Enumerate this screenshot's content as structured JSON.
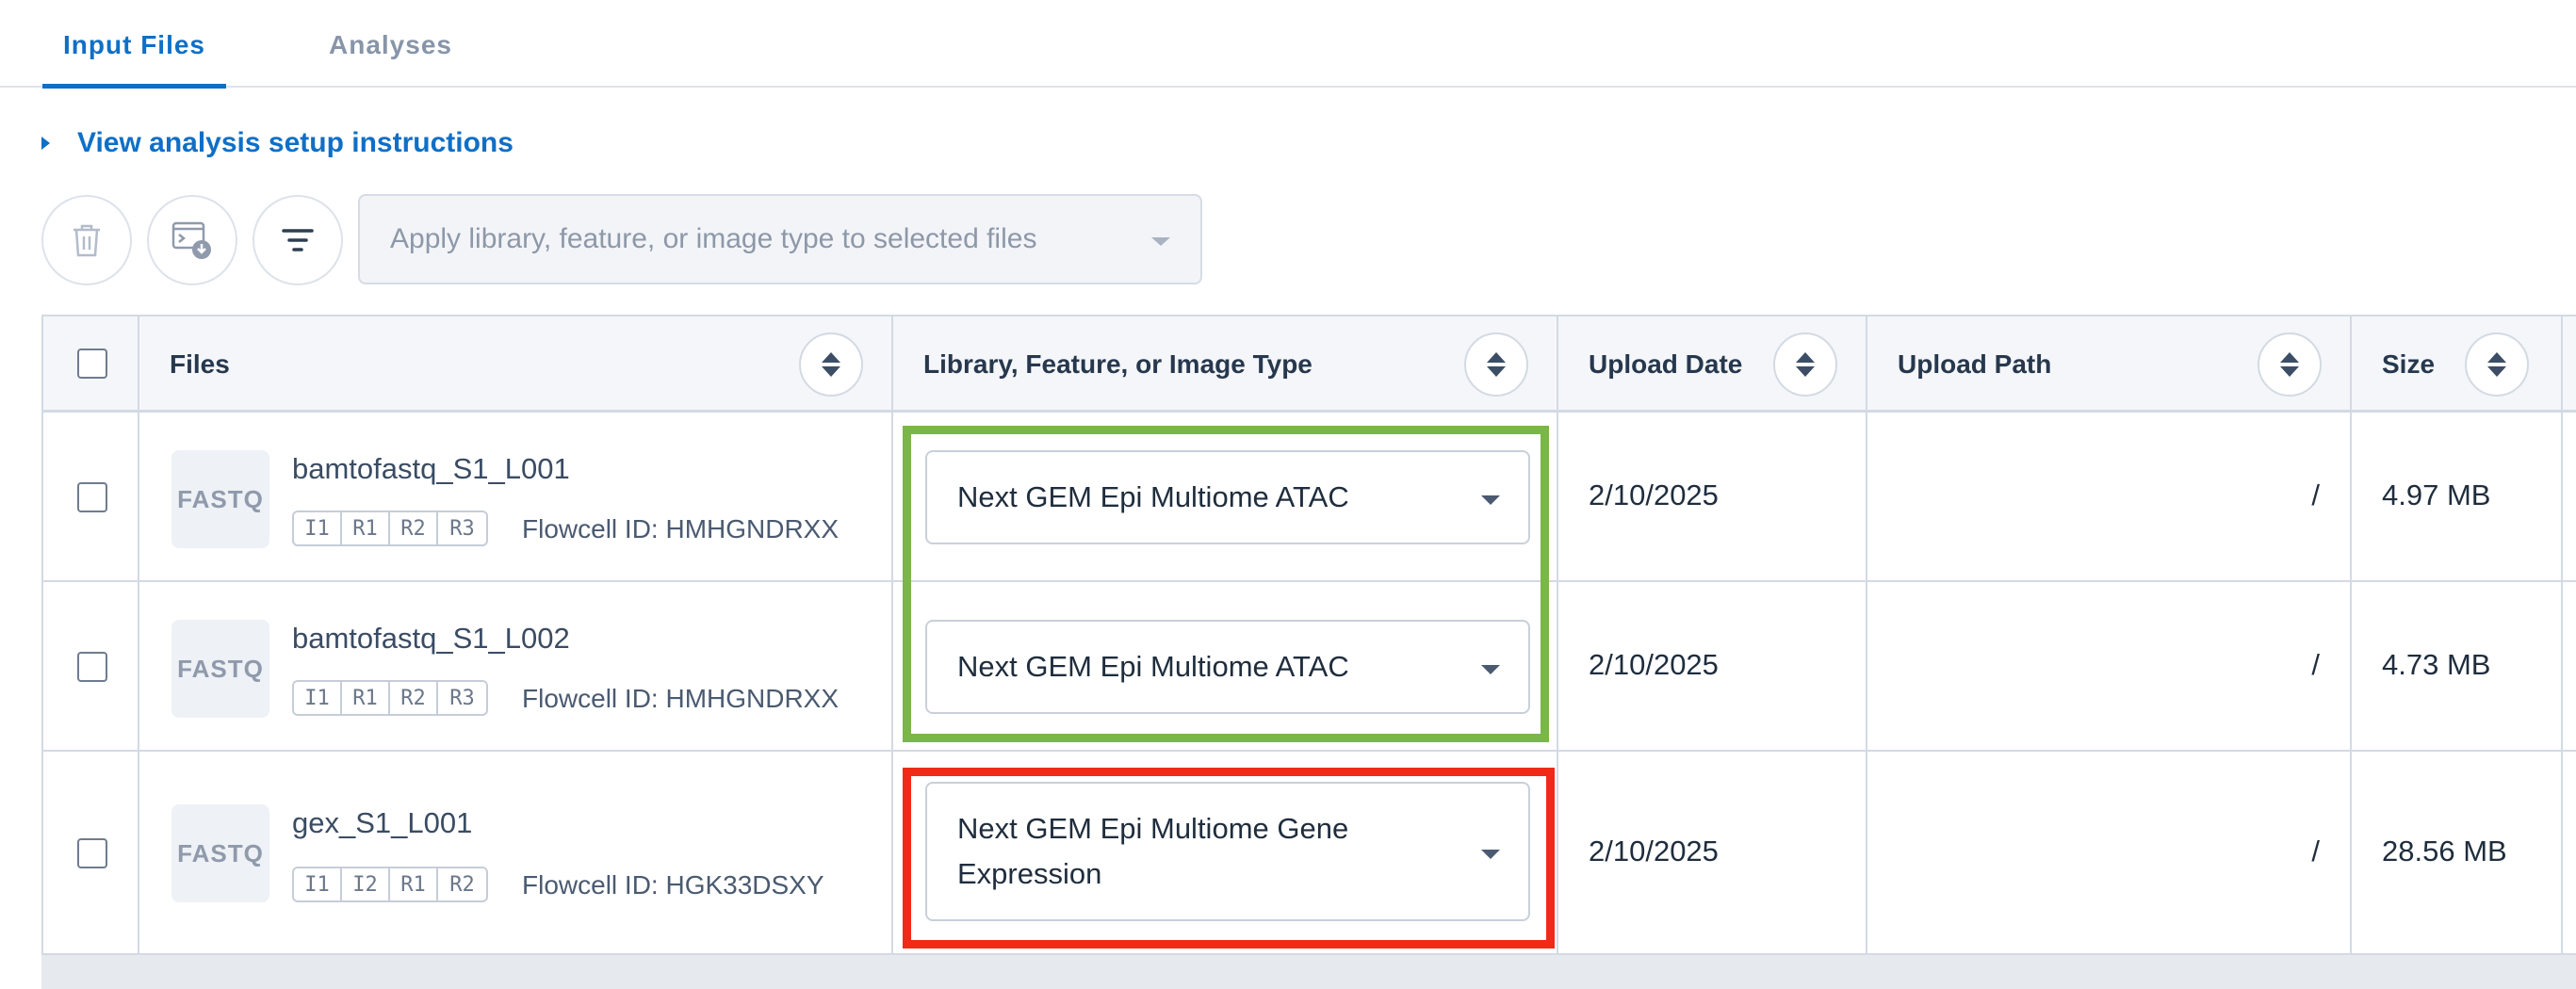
{
  "tabs": [
    {
      "label": "Input Files",
      "active": true
    },
    {
      "label": "Analyses",
      "active": false
    }
  ],
  "instructions": {
    "label": "View analysis setup instructions"
  },
  "toolbar": {
    "delete_icon": "trash-icon",
    "download_icon": "terminal-download-icon",
    "filter_icon": "filter-icon",
    "type_select_placeholder": "Apply library, feature, or image type to selected files"
  },
  "table": {
    "columns": [
      {
        "label": ""
      },
      {
        "label": "Files"
      },
      {
        "label": "Library, Feature, or Image Type"
      },
      {
        "label": "Upload Date"
      },
      {
        "label": "Upload Path"
      },
      {
        "label": "Size"
      }
    ],
    "rows": [
      {
        "badge": "FASTQ",
        "name": "bamtofastq_S1_L001",
        "reads": [
          "I1",
          "R1",
          "R2",
          "R3"
        ],
        "flowcell": "Flowcell ID: HMHGNDRXX",
        "library_type": "Next GEM Epi Multiome ATAC",
        "upload_date": "2/10/2025",
        "upload_path": "/",
        "size": "4.97 MB"
      },
      {
        "badge": "FASTQ",
        "name": "bamtofastq_S1_L002",
        "reads": [
          "I1",
          "R1",
          "R2",
          "R3"
        ],
        "flowcell": "Flowcell ID: HMHGNDRXX",
        "library_type": "Next GEM Epi Multiome ATAC",
        "upload_date": "2/10/2025",
        "upload_path": "/",
        "size": "4.73 MB"
      },
      {
        "badge": "FASTQ",
        "name": "gex_S1_L001",
        "reads": [
          "I1",
          "I2",
          "R1",
          "R2"
        ],
        "flowcell": "Flowcell ID: HGK33DSXY",
        "library_type": "Next GEM Epi Multiome Gene Expression",
        "upload_date": "2/10/2025",
        "upload_path": "/",
        "size": "28.56 MB"
      }
    ]
  },
  "colors": {
    "accent": "#0f6fc6",
    "highlight_ok": "#7ab648",
    "highlight_error": "#f02a17"
  }
}
